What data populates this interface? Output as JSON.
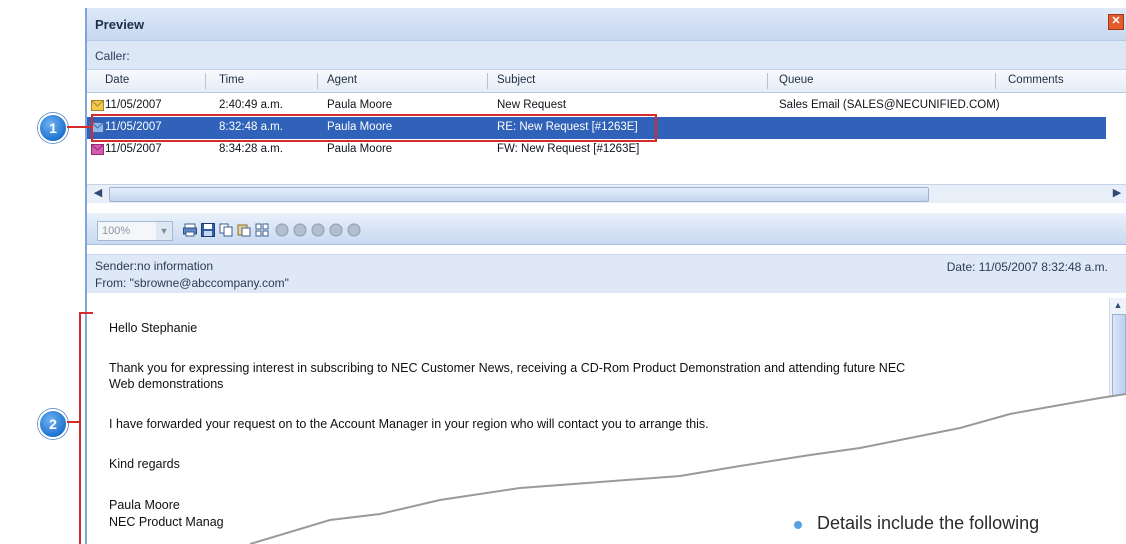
{
  "window": {
    "title": "Preview",
    "close_glyph": "✕"
  },
  "caller_label": "Caller:",
  "columns": [
    "Date",
    "Time",
    "Agent",
    "Subject",
    "Queue",
    "Comments"
  ],
  "rows": [
    {
      "date": "11/05/2007",
      "time": "2:40:49 a.m.",
      "agent": "Paula Moore",
      "subject": "New Request",
      "queue": "Sales Email (SALES@NECUNIFIED.COM)",
      "comments": "",
      "icon": "email-icon",
      "icon_color": "#f2c94c",
      "selected": false
    },
    {
      "date": "11/05/2007",
      "time": "8:32:48 a.m.",
      "agent": "Paula Moore",
      "subject": "RE: New Request [#1263E]",
      "queue": "",
      "comments": "",
      "icon": "reply-icon",
      "icon_color": "#8fb8e8",
      "selected": true
    },
    {
      "date": "11/05/2007",
      "time": "8:34:28 a.m.",
      "agent": "Paula Moore",
      "subject": "FW: New Request [#1263E]",
      "queue": "",
      "comments": "",
      "icon": "forward-icon",
      "icon_color": "#d65ab0",
      "selected": false
    }
  ],
  "toolbar": {
    "zoom": "100%"
  },
  "message": {
    "sender": "Sender:no information",
    "from": "From: \"sbrowne@abccompany.com\"",
    "date": "Date: 11/05/2007 8:32:48 a.m.",
    "lines": [
      "Hello Stephanie",
      "Thank you for expressing interest in subscribing to NEC Customer News, receiving a CD-Rom Product Demonstration and attending future NEC",
      "Web demonstrations",
      "I have forwarded your request on to the Account Manager in your region who will contact you to arrange this.",
      "Kind regards",
      "Paula Moore",
      "NEC Product Manag"
    ]
  },
  "callouts": [
    "1",
    "2"
  ],
  "bullet_text": "Details include the following",
  "colors": {
    "accent": "#2f62b8",
    "callout": "#1f74d0",
    "highlight": "#d62b2b"
  }
}
